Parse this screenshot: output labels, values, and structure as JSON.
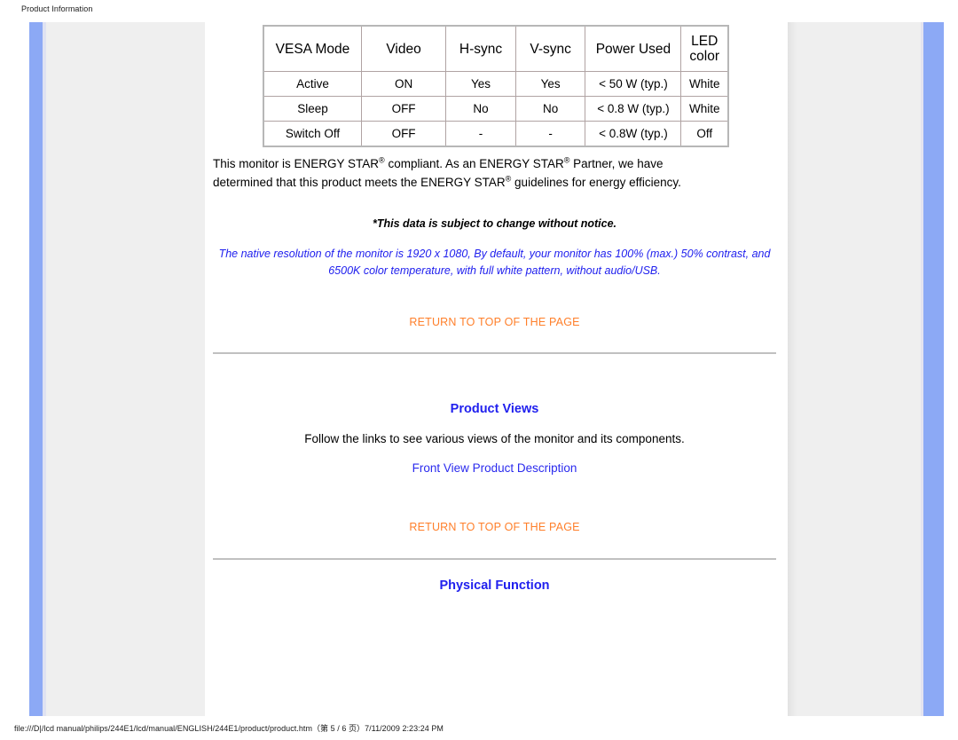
{
  "browser": {
    "header_title": "Product Information",
    "footer_status": "file:///D|/lcd manual/philips/244E1/lcd/manual/ENGLISH/244E1/product/product.htm（第 5 / 6 页）7/11/2009 2:23:24 PM"
  },
  "colors": {
    "link_orange": "#ff7f2a",
    "link_blue": "#2b2bee",
    "heading_blue": "#2020ee",
    "panel_grey": "#efefef",
    "accent_blue_bar": "#8ca9f5",
    "rule_grey": "#c0c0c0"
  },
  "power_table": {
    "headers": [
      "VESA Mode",
      "Video",
      "H-sync",
      "V-sync",
      "Power Used",
      "LED color"
    ],
    "header_led_line1": "LED",
    "header_led_line2": "color",
    "rows": [
      {
        "vesa_mode": "Active",
        "video": "ON",
        "h_sync": "Yes",
        "v_sync": "Yes",
        "power_used": "< 50 W (typ.)",
        "led_color": "White"
      },
      {
        "vesa_mode": "Sleep",
        "video": "OFF",
        "h_sync": "No",
        "v_sync": "No",
        "power_used": "< 0.8 W (typ.)",
        "led_color": "White"
      },
      {
        "vesa_mode": "Switch Off",
        "video": "OFF",
        "h_sync": "-",
        "v_sync": "-",
        "power_used": "< 0.8W (typ.)",
        "led_color": "Off"
      }
    ]
  },
  "energy_star": {
    "line1_part1": "This monitor is ENERGY STAR",
    "line1_part2": " compliant. As an ENERGY STAR",
    "line1_part3": " Partner, we have",
    "line2_part1": "determined that this product meets the ENERGY STAR",
    "line2_part2": " guidelines for energy efficiency.",
    "registered_mark": "®"
  },
  "notice": {
    "text": "*This data is subject to change without notice."
  },
  "native_resolution": {
    "line1": "The native resolution of the monitor is 1920 x 1080, By default, your monitor has 100% (max.) 50% contrast, and",
    "line2": "6500K color temperature, with full white pattern, without audio/USB."
  },
  "links": {
    "return_to_top_1": "RETURN TO TOP OF THE PAGE",
    "return_to_top_2": "RETURN TO TOP OF THE PAGE",
    "front_view_product_description": "Front View Product Description"
  },
  "sections": {
    "product_views_title": "Product Views",
    "product_views_body": "Follow the links to see various views of the monitor and its components.",
    "physical_function_title": "Physical Function"
  }
}
